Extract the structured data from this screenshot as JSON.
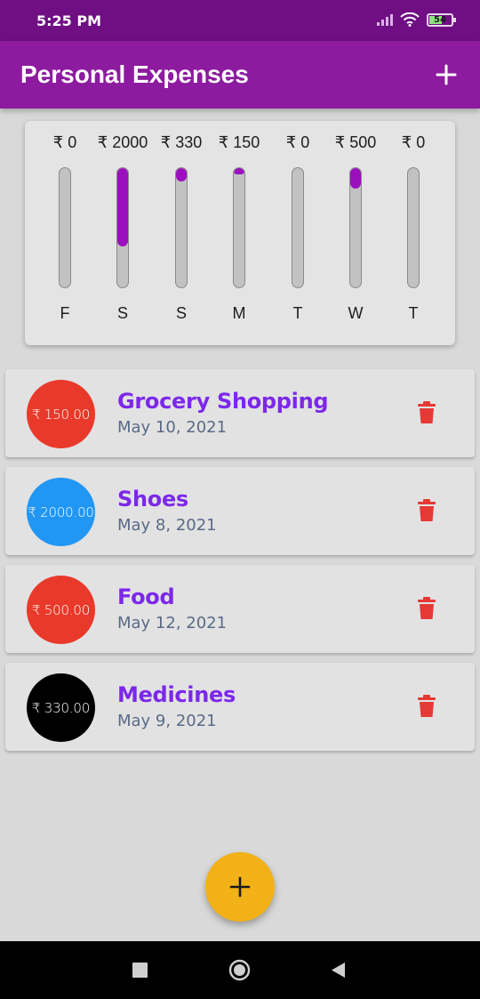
{
  "status_bar": {
    "time": "5:25 PM",
    "battery": "54"
  },
  "app_bar": {
    "title": "Personal Expenses",
    "add_icon": "plus-icon"
  },
  "chart_data": {
    "type": "bar",
    "categories": [
      "F",
      "S",
      "S",
      "M",
      "T",
      "W",
      "T"
    ],
    "amount_labels": [
      "₹ 0",
      "₹ 2000",
      "₹ 330",
      "₹ 150",
      "₹ 0",
      "₹ 500",
      "₹ 0"
    ],
    "values": [
      0,
      2000,
      330,
      150,
      0,
      500,
      0
    ],
    "fill_fraction": [
      0,
      0.66,
      0.11,
      0.05,
      0,
      0.17,
      0
    ],
    "bar_color": "#9b0fbf"
  },
  "transactions": [
    {
      "amount": "₹ 150.00",
      "title": "Grocery Shopping",
      "date": "May 10, 2021",
      "color": "#e8392a"
    },
    {
      "amount": "₹ 2000.00",
      "title": "Shoes",
      "date": "May 8, 2021",
      "color": "#2196f3"
    },
    {
      "amount": "₹ 500.00",
      "title": "Food",
      "date": "May 12, 2021",
      "color": "#e8392a"
    },
    {
      "amount": "₹ 330.00",
      "title": "Medicines",
      "date": "May 9, 2021",
      "color": "#000000"
    }
  ],
  "colors": {
    "primary": "#8d1b9f",
    "accent": "#f2b116",
    "delete": "#e53935",
    "title_text": "#7c28ea"
  },
  "fab_icon": "plus-icon",
  "nav": {
    "icons": [
      "square-recents-icon",
      "circle-home-icon",
      "triangle-back-icon"
    ]
  }
}
